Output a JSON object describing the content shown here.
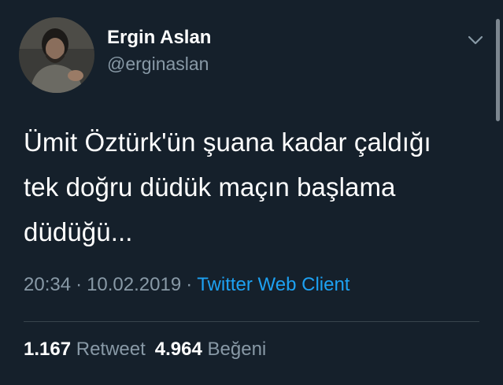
{
  "user": {
    "display_name": "Ergin Aslan",
    "handle": "@erginaslan"
  },
  "tweet": {
    "lines": [
      "Ümit Öztürk'ün şuana kadar çaldığı",
      "tek doğru düdük maçın başlama",
      "düdüğü..."
    ],
    "time": "20:34",
    "separator": "·",
    "date": "10.02.2019",
    "source": "Twitter Web Client"
  },
  "stats": {
    "retweets_count": "1.167",
    "retweets_label": "Retweet",
    "likes_count": "4.964",
    "likes_label": "Beğeni"
  },
  "colors": {
    "background": "#15202b",
    "secondary_text": "#8899a6",
    "link": "#1da1f2",
    "divider": "#38444d"
  },
  "icons": {
    "menu": "chevron-down-icon"
  }
}
